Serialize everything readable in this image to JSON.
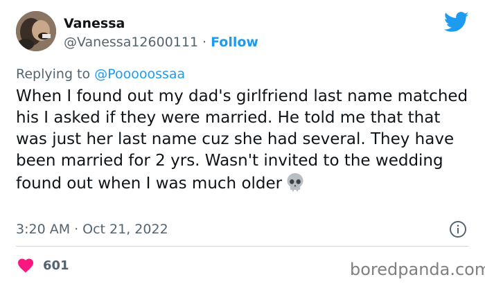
{
  "user": {
    "name": "Vanessa",
    "handle": "@Vanessa12600111",
    "separator": "·",
    "follow_label": "Follow"
  },
  "reply": {
    "prefix": "Replying to",
    "mention": "@Pooooossaa"
  },
  "tweet": {
    "text": "When I found out my dad's girlfriend last name matched his I asked if they were married. He told me that that was just her last name cuz she had several. They have been married for 2 yrs. Wasn't invited to the wedding found out when I was much older",
    "emoji_icon": "skull-icon"
  },
  "meta": {
    "time": "3:20 AM",
    "separator": "·",
    "date": "Oct 21, 2022"
  },
  "engagement": {
    "likes": "601"
  },
  "watermark": "boredpanda.com",
  "colors": {
    "accent": "#1d9bf0",
    "secondary_text": "#536471",
    "heart": "#f91880",
    "divider": "#cfd9de"
  }
}
